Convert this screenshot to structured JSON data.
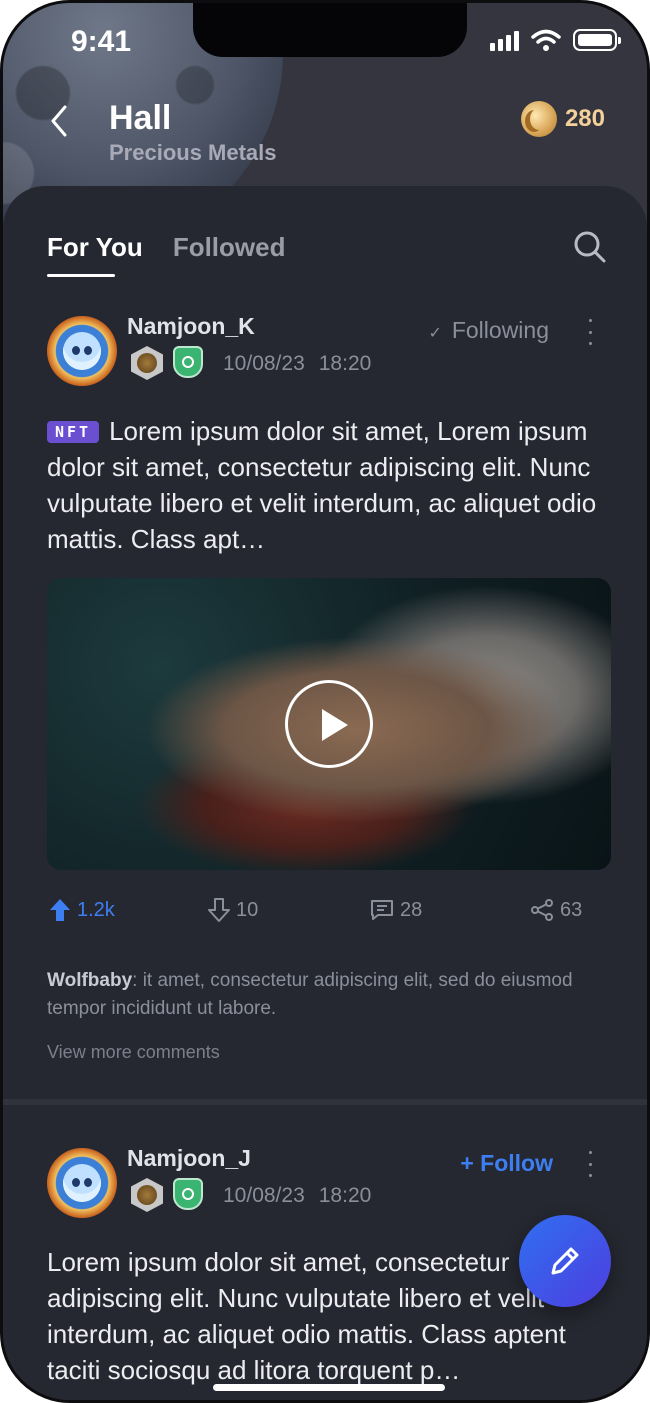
{
  "status_bar": {
    "time": "9:41"
  },
  "header": {
    "title": "Hall",
    "subtitle": "Precious Metals",
    "coin_count": "280"
  },
  "tabs": [
    {
      "label": "For You",
      "active": true
    },
    {
      "label": "Followed",
      "active": false
    }
  ],
  "posts": [
    {
      "username": "Namjoon_K",
      "date": "10/08/23",
      "time": "18:20",
      "follow_label": "Following",
      "tag": "NFT",
      "text": "Lorem ipsum dolor sit amet, Lorem ipsum dolor sit amet, consectetur adipiscing elit. Nunc vulputate libero et velit interdum, ac aliquet odio mattis. Class apt…",
      "upvotes": "1.2k",
      "downvotes": "10",
      "comments": "28",
      "shares": "63",
      "top_comment": {
        "author": "Wolfbaby",
        "text": ": it amet, consectetur adipiscing elit, sed do eiusmod tempor incididunt ut labore."
      },
      "view_more": "View more comments"
    },
    {
      "username": "Namjoon_J",
      "date": "10/08/23",
      "time": "18:20",
      "follow_label": "+ Follow",
      "text": "Lorem ipsum dolor sit amet, consectetur adipiscing elit. Nunc vulputate libero et velit interdum, ac aliquet odio mattis. Class aptent taciti sociosqu ad litora torquent p…"
    }
  ],
  "colors": {
    "accent": "#3d7ff2",
    "background": "#262831",
    "nft_tag": "#6a4fd1",
    "coin": "#f4d19a"
  },
  "icons": [
    "back-arrow-icon",
    "coin-icon",
    "search-icon",
    "more-vertical-icon",
    "check-icon",
    "play-icon",
    "upvote-icon",
    "downvote-icon",
    "comment-icon",
    "share-icon",
    "edit-pencil-icon"
  ]
}
